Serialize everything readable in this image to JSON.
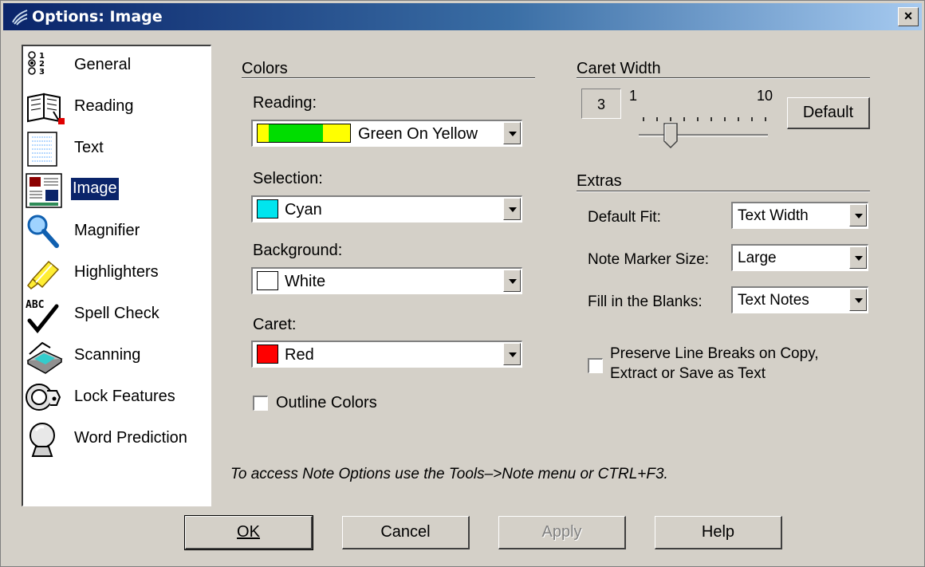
{
  "window": {
    "title": "Options: Image",
    "close_label": "×"
  },
  "nav": {
    "items": [
      {
        "label": "General",
        "icon": "radio-list-icon"
      },
      {
        "label": "Reading",
        "icon": "book-icon"
      },
      {
        "label": "Text",
        "icon": "text-page-icon"
      },
      {
        "label": "Image",
        "icon": "image-icon",
        "selected": true
      },
      {
        "label": "Magnifier",
        "icon": "magnifier-icon"
      },
      {
        "label": "Highlighters",
        "icon": "highlighter-icon"
      },
      {
        "label": "Spell Check",
        "icon": "spellcheck-icon"
      },
      {
        "label": "Scanning",
        "icon": "scanner-icon"
      },
      {
        "label": "Lock Features",
        "icon": "lock-icon"
      },
      {
        "label": "Word Prediction",
        "icon": "crystal-ball-icon"
      }
    ]
  },
  "colors": {
    "group_title": "Colors",
    "reading": {
      "label": "Reading:",
      "value": "Green On Yellow"
    },
    "selection": {
      "label": "Selection:",
      "value": "Cyan",
      "swatch": "#00e5ee"
    },
    "background": {
      "label": "Background:",
      "value": "White",
      "swatch": "#ffffff"
    },
    "caret": {
      "label": "Caret:",
      "value": "Red",
      "swatch": "#ff0000"
    },
    "outline_label": "Outline Colors"
  },
  "caret_width": {
    "group_title": "Caret Width",
    "value": "3",
    "min_label": "1",
    "max_label": "10",
    "default_button": "Default"
  },
  "extras": {
    "group_title": "Extras",
    "default_fit": {
      "label": "Default Fit:",
      "value": "Text Width"
    },
    "note_marker": {
      "label": "Note Marker Size:",
      "value": "Large"
    },
    "fill_blanks": {
      "label": "Fill in the Blanks:",
      "value": "Text Notes"
    },
    "preserve_line1": "Preserve Line Breaks on Copy,",
    "preserve_line2": "Extract or Save as Text"
  },
  "note": "To access Note Options use the Tools–>Note menu or CTRL+F3.",
  "buttons": {
    "ok": "OK",
    "cancel": "Cancel",
    "apply": "Apply",
    "help": "Help"
  }
}
